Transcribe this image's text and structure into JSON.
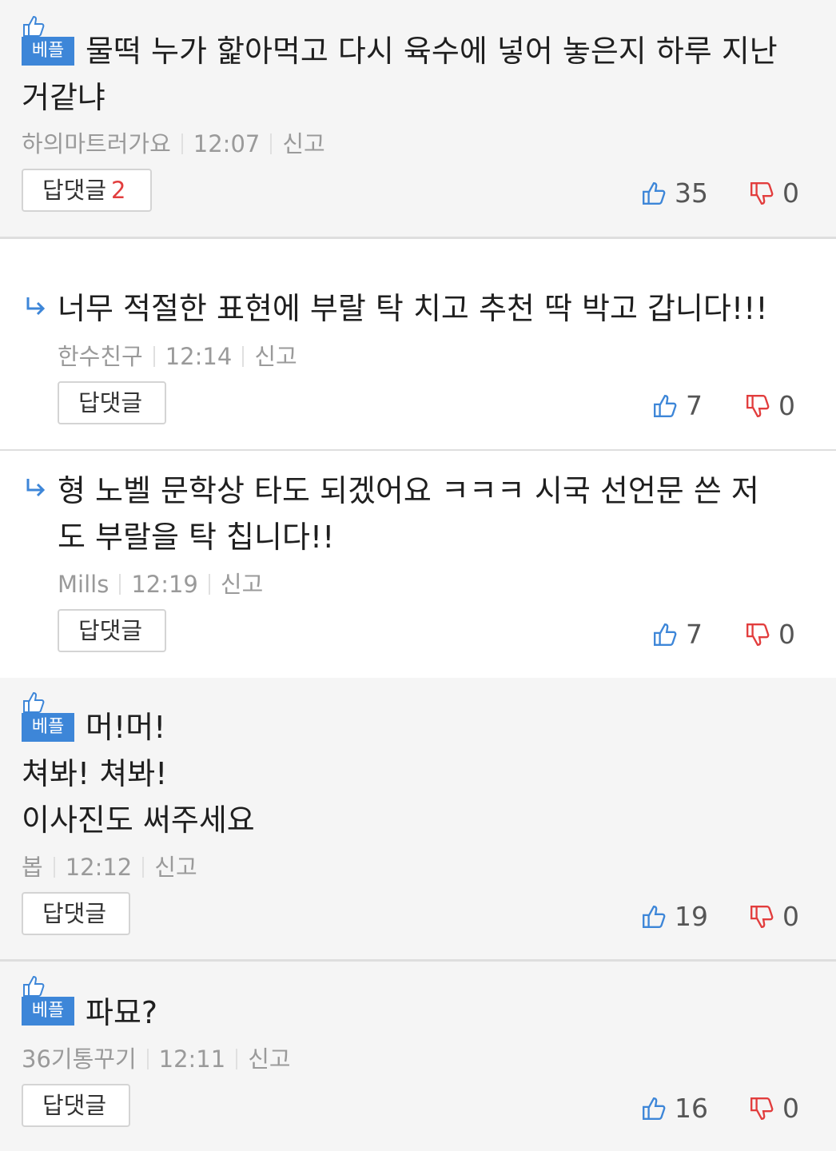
{
  "colors": {
    "best_badge": "#3d86d8",
    "like_icon": "#3d86d8",
    "dislike_icon": "#e23d3d",
    "reply_count": "#e23d3d",
    "reply_arrow": "#3d86d8"
  },
  "labels": {
    "best": "베플",
    "reply": "답댓글",
    "report": "신고"
  },
  "comments": [
    {
      "best": true,
      "text_lines": [
        "물떡 누가 핥아먹고 다시 육수에 넣어 놓은지 하루 지난",
        "거같냐"
      ],
      "author": "하의마트러가요",
      "time": "12:07",
      "reply_count": "2",
      "likes": "35",
      "dislikes": "0"
    },
    {
      "reply": true,
      "text_lines": [
        "너무 적절한 표현에 부랄 탁 치고 추천 딱 박고 갑니다!!!"
      ],
      "author": "한수친구",
      "time": "12:14",
      "likes": "7",
      "dislikes": "0"
    },
    {
      "reply": true,
      "text_lines": [
        "형 노벨 문학상 타도 되겠어요 ㅋㅋㅋ 시국 선언문 쓴 저",
        "도 부랄을 탁 칩니다!!"
      ],
      "author": "Mills",
      "time": "12:19",
      "likes": "7",
      "dislikes": "0"
    },
    {
      "best": true,
      "text_lines": [
        "머!머!",
        "쳐봐! 쳐봐!",
        "이사진도 써주세요"
      ],
      "author": "봅",
      "time": "12:12",
      "likes": "19",
      "dislikes": "0"
    },
    {
      "best": true,
      "text_lines": [
        "파묘?"
      ],
      "author": "36기통꾸기",
      "time": "12:11",
      "likes": "16",
      "dislikes": "0"
    }
  ]
}
